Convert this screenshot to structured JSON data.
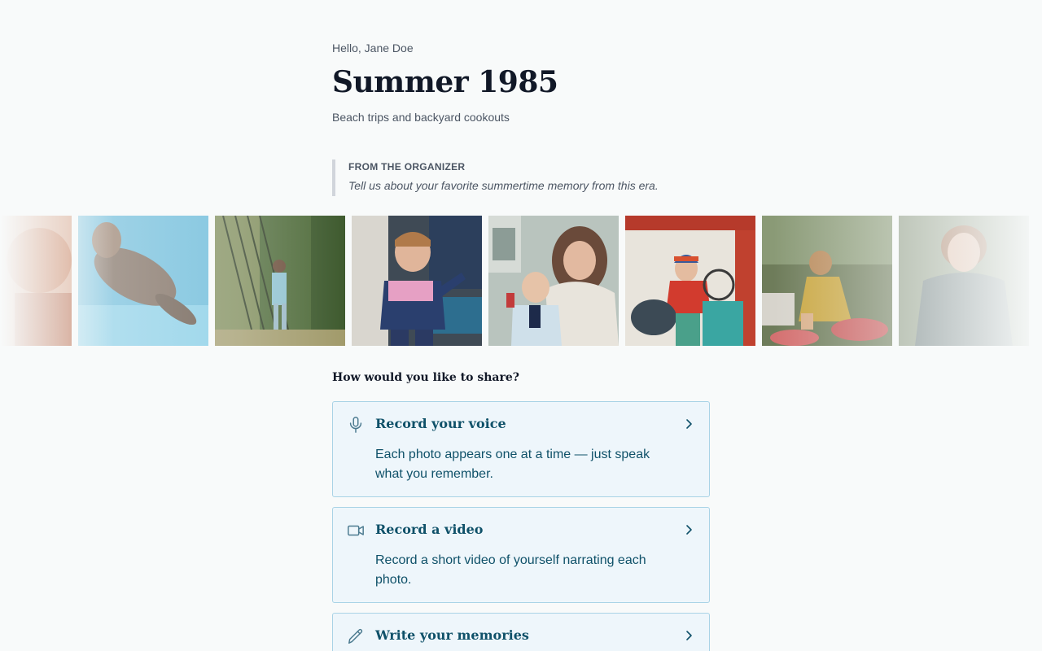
{
  "header": {
    "greeting": "Hello, Jane Doe",
    "title": "Summer 1985",
    "subtitle": "Beach trips and backyard cookouts"
  },
  "organizer": {
    "label": "FROM THE ORGANIZER",
    "message": "Tell us about your favorite summertime memory from this era."
  },
  "photos": [
    {
      "name": "photo-warm-portrait"
    },
    {
      "name": "photo-pool-swimmer"
    },
    {
      "name": "photo-garden-fence"
    },
    {
      "name": "photo-toddler-pointing"
    },
    {
      "name": "photo-mother-and-baby"
    },
    {
      "name": "photo-child-on-tractor"
    },
    {
      "name": "photo-girl-in-garden"
    },
    {
      "name": "photo-older-woman"
    }
  ],
  "share": {
    "question": "How would you like to share?",
    "options": [
      {
        "title": "Record your voice",
        "description": "Each photo appears one at a time — just speak what you remember.",
        "icon": "microphone-icon"
      },
      {
        "title": "Record a video",
        "description": "Record a short video of yourself narrating each photo.",
        "icon": "video-camera-icon"
      },
      {
        "title": "Write your memories",
        "description": "",
        "icon": "pencil-icon"
      }
    ]
  },
  "colors": {
    "background": "#f8fafa",
    "option_bg": "#eef6fb",
    "option_border": "#a9d3e6",
    "accent_text": "#0f5169"
  }
}
